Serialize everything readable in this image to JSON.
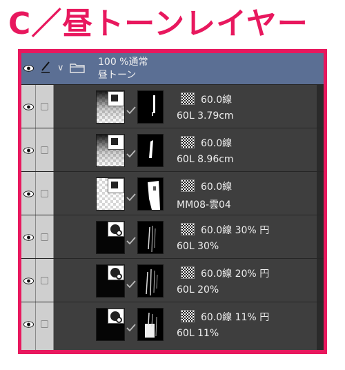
{
  "heading": "C／昼トーンレイヤー",
  "folder": {
    "opacity": "100 %通常",
    "name": "昼トーン"
  },
  "layers": [
    {
      "tone": "60.0線",
      "name": "60L 3.79cm",
      "thumb": "gradient",
      "mask": "strip-a"
    },
    {
      "tone": "60.0線",
      "name": "60L 8.96cm",
      "thumb": "gradient",
      "mask": "strip-b"
    },
    {
      "tone": "60.0線",
      "name": "MM08-雲04",
      "thumb": "checker",
      "mask": "cloud"
    },
    {
      "tone": "60.0線 30% 円",
      "name": "60L 30%",
      "thumb": "black",
      "mask": "lines"
    },
    {
      "tone": "60.0線 20% 円",
      "name": "60L 20%",
      "thumb": "black",
      "mask": "lines"
    },
    {
      "tone": "60.0線 11% 円",
      "name": "60L 11%",
      "thumb": "black",
      "mask": "lines"
    }
  ],
  "colors": {
    "accent": "#e8185e",
    "panel": "#3e3e3e",
    "folder_row": "#5b6f94",
    "column": "#cfcfcf"
  },
  "icons": {
    "visibility": "eye-icon",
    "edit": "pen-icon",
    "folder": "folder-icon",
    "expand": "chevron-down-icon",
    "tone": "screentone-icon",
    "checked": "check-icon",
    "layer_type": "tone-layer-icon"
  }
}
